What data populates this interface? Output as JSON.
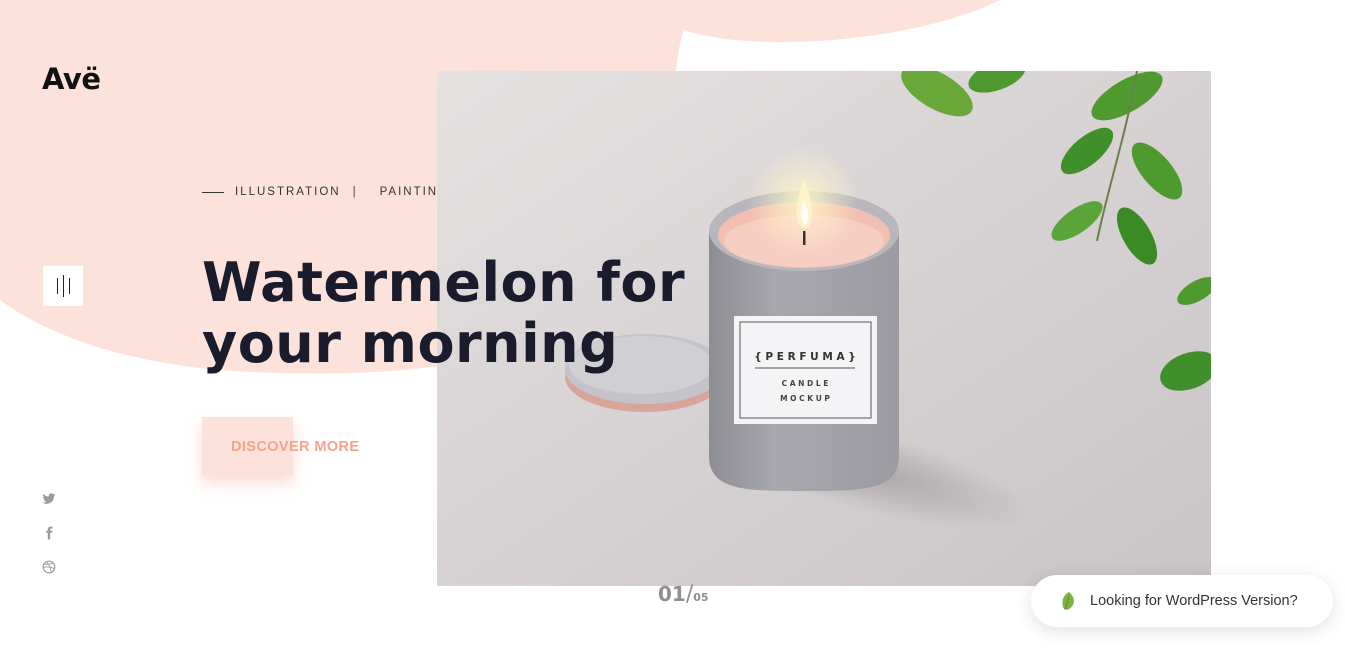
{
  "brand": {
    "logo_text": "Avë",
    "accent": "#f28d74",
    "blob_color": "#fde2dc"
  },
  "nav": {
    "menu_icon": "menu-bars-icon"
  },
  "slide": {
    "categories": [
      "ILLUSTRATION",
      "PAINTING"
    ],
    "separator": "|",
    "title_line1": "Watermelon for",
    "title_line2": "your morning",
    "cta_label": "DISCOVER MORE",
    "image": {
      "label_brand": "{ P E R F U M A }",
      "label_line1": "C A N D L E",
      "label_line2": "M O C K U P"
    }
  },
  "socials": [
    {
      "icon": "twitter-icon"
    },
    {
      "icon": "facebook-icon"
    },
    {
      "icon": "dribbble-icon"
    }
  ],
  "pagination": {
    "current": "01",
    "slash": "/",
    "total": "05"
  },
  "wordpress_banner": {
    "text": "Looking for WordPress Version?",
    "icon": "leaf-icon",
    "icon_color": "#7cb342"
  }
}
